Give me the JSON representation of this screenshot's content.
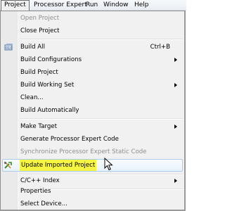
{
  "menubar": {
    "items": [
      "Project",
      "Processor Expert",
      "Run",
      "Window",
      "Help"
    ]
  },
  "menu": {
    "items": [
      {
        "label": "Open Project"
      },
      {
        "label": "Close Project"
      },
      {
        "label": "Build All",
        "shortcut": "Ctrl+B",
        "icon": "build-all-icon"
      },
      {
        "label": "Build Configurations"
      },
      {
        "label": "Build Project"
      },
      {
        "label": "Build Working Set"
      },
      {
        "label": "Clean..."
      },
      {
        "label": "Build Automatically"
      },
      {
        "label": "Make Target"
      },
      {
        "label": "Generate Processor Expert Code"
      },
      {
        "label": "Synchronize Processor Expert Static Code"
      },
      {
        "label": "Update Imported Project",
        "icon": "update-project-icon"
      },
      {
        "label": "C/C++ Index"
      },
      {
        "label": "Properties"
      },
      {
        "label": "Select Device..."
      }
    ]
  },
  "colors": {
    "highlight_text_bg": "#f5f542",
    "hover_border": "#a8cbee",
    "disabled_text": "#8e8e8e"
  }
}
